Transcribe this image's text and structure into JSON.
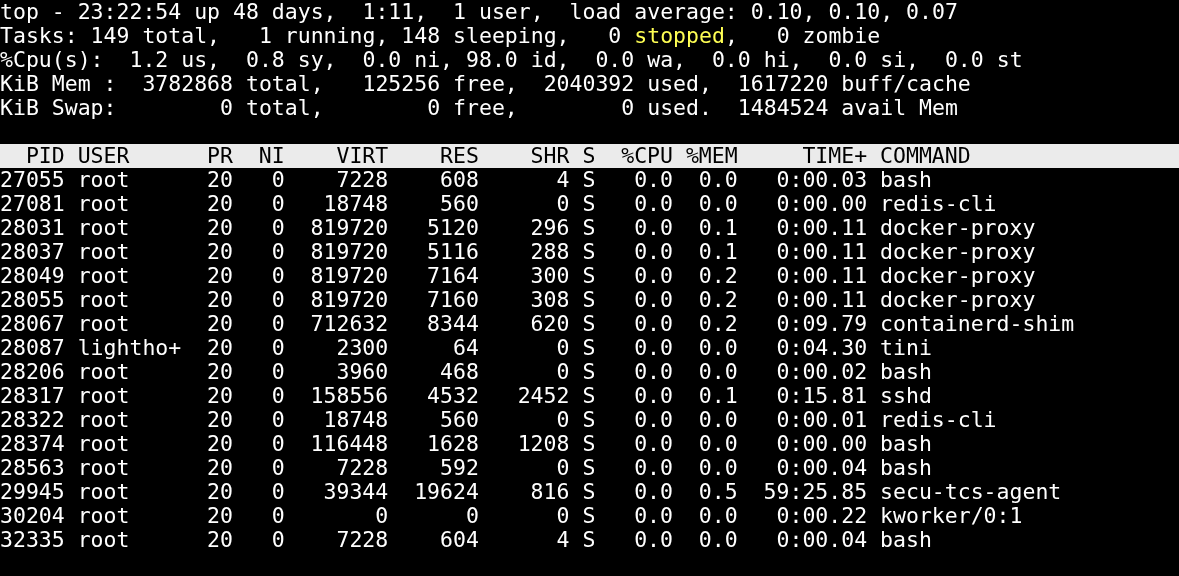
{
  "summary": [
    [
      {
        "text": "top - 23:22:54 up 48 days,  1:11,  1 user,  load average: 0.10, 0.10, 0.07",
        "kind": "plain"
      }
    ],
    [
      {
        "text": "Tasks: 149 total,   1 running, 148 sleeping,   0 ",
        "kind": "plain"
      },
      {
        "text": "stopped",
        "kind": "warning"
      },
      {
        "text": ",   0 zombie",
        "kind": "plain"
      }
    ],
    [
      {
        "text": "%Cpu(s):  1.2 us,  0.8 sy,  0.0 ni, 98.0 id,  0.0 wa,  0.0 hi,  0.0 si,  0.0 st",
        "kind": "plain"
      }
    ],
    [
      {
        "text": "KiB Mem :  3782868 total,   125256 free,  2040392 used,  1617220 buff/cache",
        "kind": "plain"
      }
    ],
    [
      {
        "text": "KiB Swap:        0 total,        0 free,        0 used.  1484524 avail Mem",
        "kind": "plain"
      }
    ]
  ],
  "table": {
    "columns": [
      "PID",
      "USER",
      "PR",
      "NI",
      "VIRT",
      "RES",
      "SHR",
      "S",
      "%CPU",
      "%MEM",
      "TIME+",
      "COMMAND"
    ],
    "rows": [
      [
        "27055",
        "root",
        "20",
        "0",
        "7228",
        "608",
        "4",
        "S",
        "0.0",
        "0.0",
        "0:00.03",
        "bash"
      ],
      [
        "27081",
        "root",
        "20",
        "0",
        "18748",
        "560",
        "0",
        "S",
        "0.0",
        "0.0",
        "0:00.00",
        "redis-cli"
      ],
      [
        "28031",
        "root",
        "20",
        "0",
        "819720",
        "5120",
        "296",
        "S",
        "0.0",
        "0.1",
        "0:00.11",
        "docker-proxy"
      ],
      [
        "28037",
        "root",
        "20",
        "0",
        "819720",
        "5116",
        "288",
        "S",
        "0.0",
        "0.1",
        "0:00.11",
        "docker-proxy"
      ],
      [
        "28049",
        "root",
        "20",
        "0",
        "819720",
        "7164",
        "300",
        "S",
        "0.0",
        "0.2",
        "0:00.11",
        "docker-proxy"
      ],
      [
        "28055",
        "root",
        "20",
        "0",
        "819720",
        "7160",
        "308",
        "S",
        "0.0",
        "0.2",
        "0:00.11",
        "docker-proxy"
      ],
      [
        "28067",
        "root",
        "20",
        "0",
        "712632",
        "8344",
        "620",
        "S",
        "0.0",
        "0.2",
        "0:09.79",
        "containerd-shim"
      ],
      [
        "28087",
        "lightho+",
        "20",
        "0",
        "2300",
        "64",
        "0",
        "S",
        "0.0",
        "0.0",
        "0:04.30",
        "tini"
      ],
      [
        "28206",
        "root",
        "20",
        "0",
        "3960",
        "468",
        "0",
        "S",
        "0.0",
        "0.0",
        "0:00.02",
        "bash"
      ],
      [
        "28317",
        "root",
        "20",
        "0",
        "158556",
        "4532",
        "2452",
        "S",
        "0.0",
        "0.1",
        "0:15.81",
        "sshd"
      ],
      [
        "28322",
        "root",
        "20",
        "0",
        "18748",
        "560",
        "0",
        "S",
        "0.0",
        "0.0",
        "0:00.01",
        "redis-cli"
      ],
      [
        "28374",
        "root",
        "20",
        "0",
        "116448",
        "1628",
        "1208",
        "S",
        "0.0",
        "0.0",
        "0:00.00",
        "bash"
      ],
      [
        "28563",
        "root",
        "20",
        "0",
        "7228",
        "592",
        "0",
        "S",
        "0.0",
        "0.0",
        "0:00.04",
        "bash"
      ],
      [
        "29945",
        "root",
        "20",
        "0",
        "39344",
        "19624",
        "816",
        "S",
        "0.0",
        "0.5",
        "59:25.85",
        "secu-tcs-agent"
      ],
      [
        "30204",
        "root",
        "20",
        "0",
        "0",
        "0",
        "0",
        "S",
        "0.0",
        "0.0",
        "0:00.22",
        "kworker/0:1"
      ],
      [
        "32335",
        "root",
        "20",
        "0",
        "7228",
        "604",
        "4",
        "S",
        "0.0",
        "0.0",
        "0:00.04",
        "bash"
      ]
    ]
  }
}
